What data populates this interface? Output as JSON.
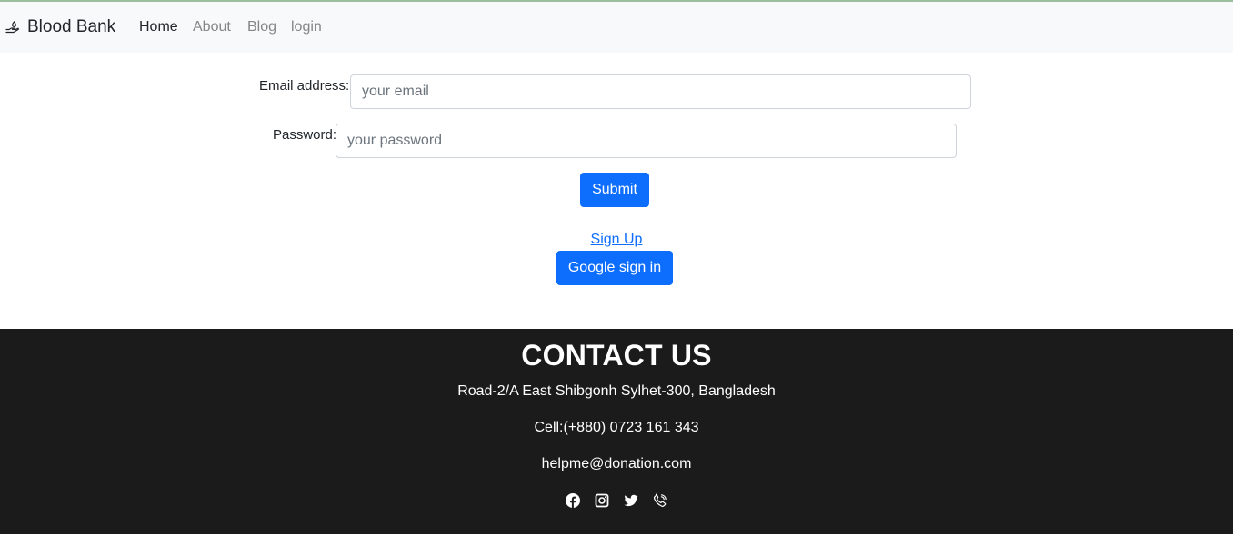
{
  "nav": {
    "brand": "Blood Bank",
    "brand_icon": "blood-donation-icon",
    "links": [
      {
        "label": "Home",
        "active": true
      },
      {
        "label": "About",
        "active": false
      },
      {
        "label": "Blog",
        "active": false
      },
      {
        "label": "login",
        "active": false
      }
    ]
  },
  "form": {
    "email_label": "Email address:",
    "email_placeholder": "your email",
    "email_value": "",
    "password_label": "Password:",
    "password_placeholder": "your password",
    "password_value": "",
    "submit_label": "Submit",
    "signup_label": "Sign Up",
    "google_label": "Google sign in"
  },
  "footer": {
    "title": "CONTACT US",
    "address": "Road-2/A East Shibgonh Sylhet-300, Bangladesh",
    "cell": "Cell:(+880) 0723 161 343",
    "email": "helpme@donation.com",
    "social_icons": [
      "facebook-icon",
      "instagram-icon",
      "twitter-icon",
      "phone-icon"
    ]
  },
  "colors": {
    "primary": "#0d6efd",
    "navbar_bg": "#f8f9fa",
    "footer_bg": "#1b1b1b"
  }
}
